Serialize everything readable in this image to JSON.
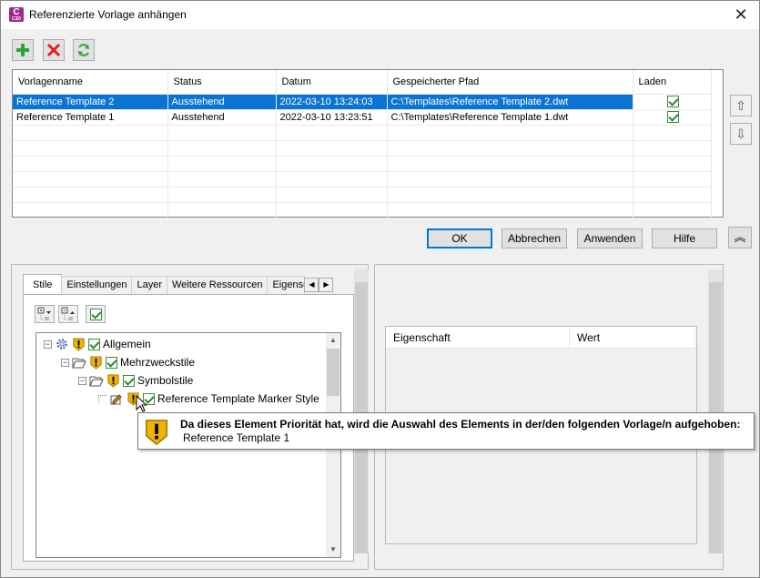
{
  "window": {
    "title": "Referenzierte Vorlage anhängen",
    "app_icon_letter": "C",
    "app_icon_version": "C3D",
    "close_glyph": "✕"
  },
  "toolbar": {
    "add_icon": "plus-icon",
    "remove_icon": "red-x-icon",
    "refresh_icon": "refresh-icon"
  },
  "templates_table": {
    "columns": [
      "Vorlagenname",
      "Status",
      "Datum",
      "Gespeicherter Pfad",
      "Laden"
    ],
    "rows": [
      {
        "name": "Reference Template 2",
        "status": "Ausstehend",
        "date": "2022-03-10 13:24:03",
        "path": "C:\\Templates\\Reference Template 2.dwt",
        "load": true,
        "selected": true
      },
      {
        "name": "Reference Template 1",
        "status": "Ausstehend",
        "date": "2022-03-10 13:23:51",
        "path": "C:\\Templates\\Reference Template 1.dwt",
        "load": true,
        "selected": false
      }
    ]
  },
  "side_buttons": {
    "up": "⇧",
    "down": "⇩"
  },
  "buttons": {
    "ok": "OK",
    "cancel": "Abbrechen",
    "apply": "Anwenden",
    "help": "Hilfe",
    "collapse": "︽"
  },
  "tabs": [
    "Stile",
    "Einstellungen",
    "Layer",
    "Weitere Ressourcen",
    "Eigenscha"
  ],
  "tab_nav": {
    "left": "◀",
    "right": "▶"
  },
  "tree": {
    "nodes": [
      {
        "label": "Allgemein",
        "expander": "−",
        "checked": true,
        "warn": true
      },
      {
        "label": "Mehrzweckstile",
        "expander": "−",
        "checked": true,
        "warn": true
      },
      {
        "label": "Symbolstile",
        "expander": "−",
        "checked": true,
        "warn": true
      },
      {
        "label": "Reference Template Marker Style",
        "expander": "",
        "checked": true,
        "warn": true
      }
    ]
  },
  "properties": {
    "columns": [
      "Eigenschaft",
      "Wert"
    ]
  },
  "tooltip": {
    "message": "Da dieses Element Priorität hat, wird die Auswahl des Elements in der/den folgenden Vorlage/n aufgehoben:",
    "template": "Reference Template 1"
  },
  "scroll_glyphs": {
    "up": "▲",
    "down": "▼"
  },
  "colors": {
    "selection": "#0a74d4",
    "warning": "#f0b400",
    "brand": "#9c2a8c"
  }
}
